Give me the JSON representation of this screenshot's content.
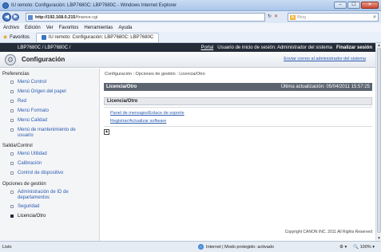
{
  "window": {
    "title": "IU remoto: Configuración: LBP7680C: LBP7680C - Windows Internet Explorer",
    "controls": [
      "–",
      "☐",
      "✕"
    ]
  },
  "browser": {
    "url_host": "http://192.168.0.215",
    "url_path": "/finance.cgi",
    "search_provider": "Bing",
    "menu": [
      "Archivo",
      "Edición",
      "Ver",
      "Favoritos",
      "Herramientas",
      "Ayuda"
    ],
    "favorites_label": "Favoritos",
    "tab_label": "IU remoto: Configuración: LBP7680C: LBP7680C"
  },
  "top_bar": {
    "model": "LBP7680C / LBP7680C /",
    "portal": "Portal",
    "login_status": "Usuario de inicio de sesión: Administrador del sistema",
    "logout": "Finalizar sesión"
  },
  "header": {
    "title": "Configuración",
    "mail_link": "Enviar correo al administrador del sistema"
  },
  "sidebar": {
    "sections": [
      {
        "label": "Preferencias",
        "items": [
          "Menú Control",
          "Menú Origen del papel",
          "Red",
          "Menú Formato",
          "Menú Calidad",
          "Menú de mantenimiento de usuario"
        ]
      },
      {
        "label": "Salida/Control",
        "items": [
          "Menú Utilidad",
          "Calibración",
          "Control de dispositivo"
        ]
      },
      {
        "label": "Opciones de gestión",
        "items": [
          "Administración de ID de departamentos",
          "Seguridad",
          "Licencia/Otro"
        ]
      }
    ]
  },
  "main": {
    "breadcrumb": "Configuración : Opciones de gestión : Licencia/Otro",
    "bar_title": "Licencia/Otro",
    "last_update": "Última actualización: 05/04/2011 15:57:25",
    "sub_title": "Licencia/Otro",
    "links": [
      "Panel de mensajes/Enlace de soporte",
      "Registrar/Actualizar software"
    ],
    "copyright": "Copyright CANON INC. 2011 All Rights Reserved"
  },
  "status_bar": {
    "left": "Listo",
    "mid": "Internet | Modo protegido: activado",
    "zoom": "100%"
  }
}
